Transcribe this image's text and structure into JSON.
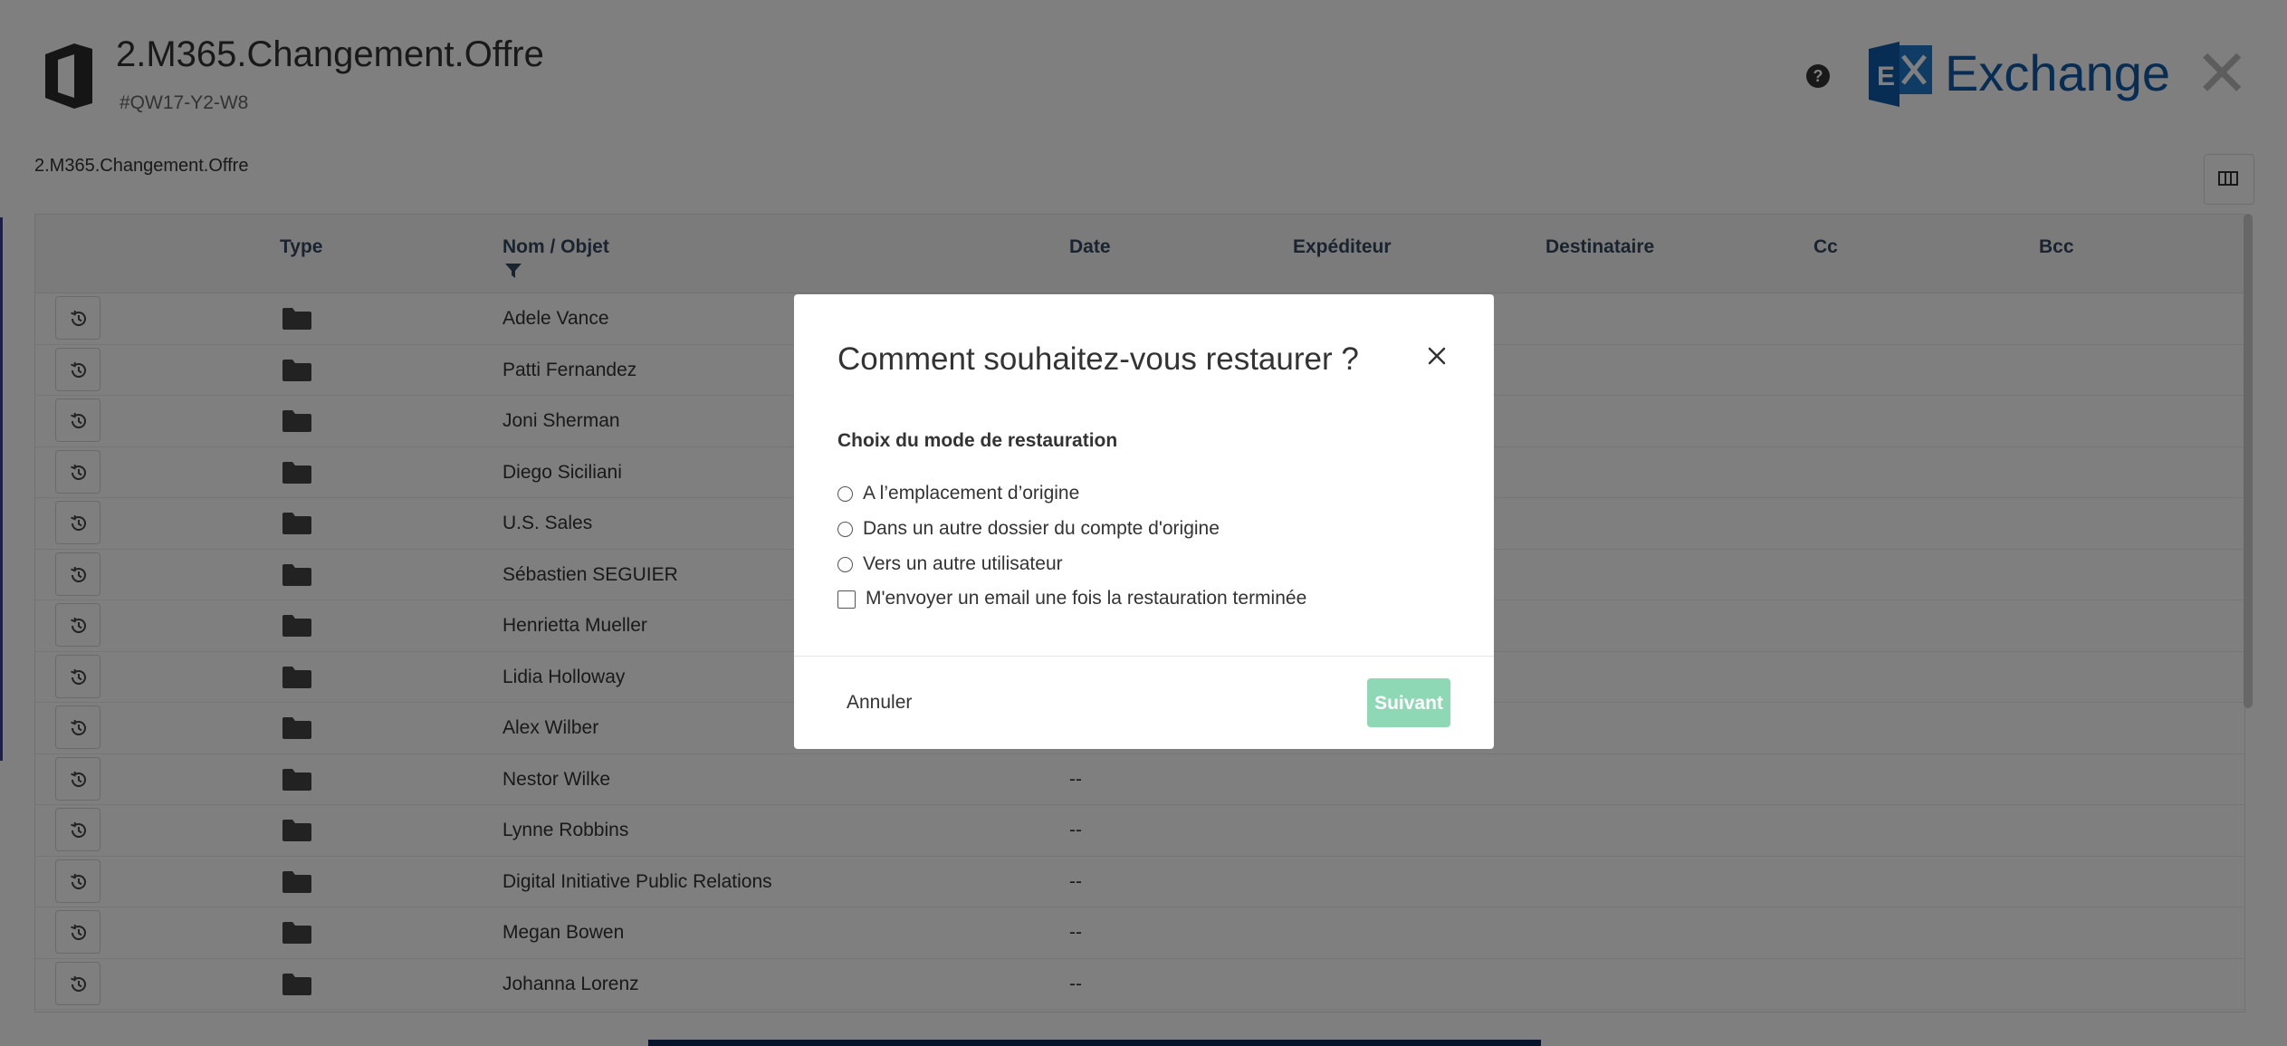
{
  "header": {
    "title": "2.M365.Changement.Offre",
    "subtitle": "#QW17-Y2-W8",
    "help_symbol": "?",
    "product_name": "Exchange",
    "close_symbol": "✕"
  },
  "breadcrumb": "2.M365.Changement.Offre",
  "table": {
    "columns": {
      "type": "Type",
      "name": "Nom / Objet",
      "date": "Date",
      "sender": "Expéditeur",
      "recipient": "Destinataire",
      "cc": "Cc",
      "bcc": "Bcc"
    },
    "rows": [
      {
        "name": "Adele Vance",
        "date": ""
      },
      {
        "name": "Patti Fernandez",
        "date": ""
      },
      {
        "name": "Joni Sherman",
        "date": ""
      },
      {
        "name": "Diego Siciliani",
        "date": ""
      },
      {
        "name": "U.S. Sales",
        "date": ""
      },
      {
        "name": "Sébastien SEGUIER",
        "date": ""
      },
      {
        "name": "Henrietta Mueller",
        "date": ""
      },
      {
        "name": "Lidia Holloway",
        "date": ""
      },
      {
        "name": "Alex Wilber",
        "date": ""
      },
      {
        "name": "Nestor Wilke",
        "date": "--"
      },
      {
        "name": "Lynne Robbins",
        "date": "--"
      },
      {
        "name": "Digital Initiative Public Relations",
        "date": "--"
      },
      {
        "name": "Megan Bowen",
        "date": "--"
      },
      {
        "name": "Johanna Lorenz",
        "date": "--"
      }
    ]
  },
  "modal": {
    "title": "Comment souhaitez-vous restaurer ?",
    "section_label": "Choix du mode de restauration",
    "options": [
      "A l’emplacement d’origine",
      "Dans un autre dossier du compte d'origine",
      "Vers un autre utilisateur"
    ],
    "email_checkbox": "M'envoyer un email une fois la restauration terminée",
    "cancel_label": "Annuler",
    "next_label": "Suivant"
  },
  "colors": {
    "accent_exchange": "#0f5aa8",
    "next_button_disabled": "#8fd8b6",
    "header_text": "#34495e"
  }
}
